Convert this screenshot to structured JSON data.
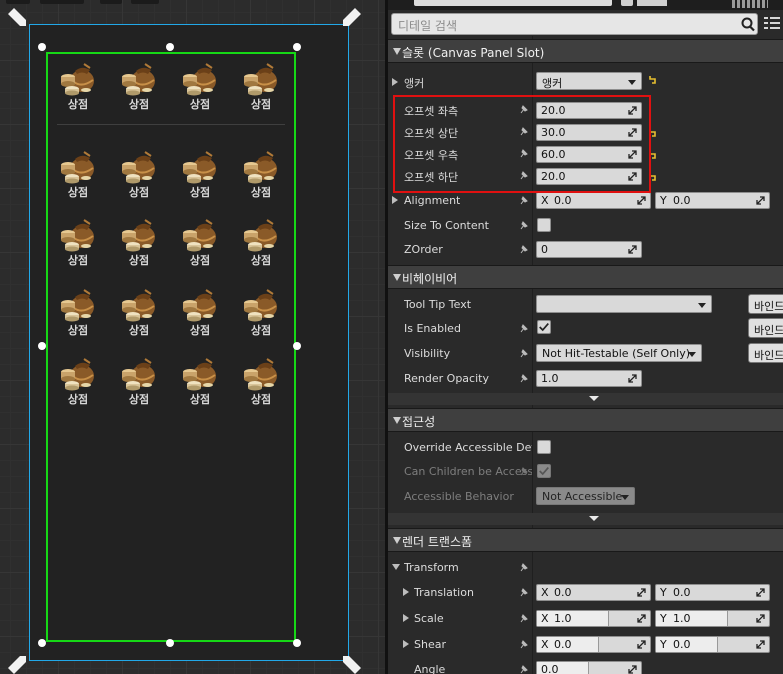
{
  "canvas": {
    "item_label": "상점",
    "grid_items": [
      "상점",
      "상점",
      "상점",
      "상점",
      "상점",
      "상점",
      "상점",
      "상점",
      "상점",
      "상점",
      "상점",
      "상점",
      "상점",
      "상점",
      "상점",
      "상점",
      "상점",
      "상점",
      "상점",
      "상점"
    ]
  },
  "details": {
    "search_placeholder": "디테일 검색",
    "slot_section": {
      "title": "슬롯 (Canvas Panel Slot)"
    },
    "anchor": {
      "label": "앵커",
      "value": "앵커"
    },
    "offsets": [
      {
        "label": "오프셋 좌측",
        "value": "20.0"
      },
      {
        "label": "오프셋 상단",
        "value": "30.0"
      },
      {
        "label": "오프셋 우측",
        "value": "60.0"
      },
      {
        "label": "오프셋 하단",
        "value": "20.0"
      }
    ],
    "alignment": {
      "label": "Alignment",
      "x_axis": "X",
      "x": "0.0",
      "y_axis": "Y",
      "y": "0.0"
    },
    "size_to_content": {
      "label": "Size To Content"
    },
    "zorder": {
      "label": "ZOrder",
      "value": "0"
    },
    "behavior_section": {
      "title": "비헤이비어"
    },
    "tooltip": {
      "label": "Tool Tip Text",
      "bind": "바인드"
    },
    "is_enabled": {
      "label": "Is Enabled",
      "checked": true,
      "bind": "바인드"
    },
    "visibility": {
      "label": "Visibility",
      "value": "Not Hit-Testable (Self Only)",
      "bind": "바인드"
    },
    "render_opacity": {
      "label": "Render Opacity",
      "value": "1.0"
    },
    "access_section": {
      "title": "접근성"
    },
    "override_access": {
      "label": "Override Accessible Defaults",
      "checked": false
    },
    "can_children": {
      "label": "Can Children be Accessible",
      "checked": true
    },
    "accessible_behavior": {
      "label": "Accessible Behavior",
      "value": "Not Accessible"
    },
    "render_section": {
      "title": "렌더 트랜스폼"
    },
    "transform": {
      "label": "Transform"
    },
    "translation": {
      "label": "Translation",
      "x_axis": "X",
      "x": "0.0",
      "y_axis": "Y",
      "y": "0.0"
    },
    "scale": {
      "label": "Scale",
      "x_axis": "X",
      "x": "1.0",
      "y_axis": "Y",
      "y": "1.0"
    },
    "shear": {
      "label": "Shear",
      "x_axis": "X",
      "x": "0.0",
      "y_axis": "Y",
      "y": "0.0"
    },
    "angle": {
      "label": "Angle",
      "value": "0.0"
    }
  },
  "colors": {
    "canvas_outline": "#22a8e8",
    "widget_outline": "#16d816",
    "highlight_box": "#e01010",
    "reset_arrow": "#e8c030"
  },
  "icons": [
    "shop-bag-icon",
    "search-icon",
    "grid-view-icon",
    "pin-icon",
    "reset-arrow-icon",
    "expand-arrow-icon",
    "collapse-arrow-icon"
  ]
}
